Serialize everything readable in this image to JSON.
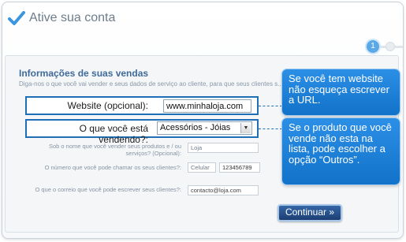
{
  "header": {
    "title": "Ative sua conta"
  },
  "steps": {
    "current": "1"
  },
  "section": {
    "title": "Informações de suas vendas",
    "description": "Diga-nos o que você vai vender e seus dados de serviço ao cliente, para que seus clientes s..."
  },
  "fields": {
    "website_label": "Website (opcional):",
    "website_value": "www.minhaloja.com",
    "selling_label": "O que você está vendendo?:",
    "selling_value": "Acessórios - Jóias",
    "name_label": "Sob o nome que você vender seus produtos e / ou serviços? (Opcional):",
    "name_value": "Loja",
    "phone_label": "O número que você pode chamar os seus clientes?:",
    "phone_type": "Celular",
    "phone_value": "123456789",
    "email_label": "O que o correio que você pode escrever seus clientes?:",
    "email_value": "contacto@loja.com"
  },
  "tips": {
    "website": "Se você tem website não esqueça escrever a URL.",
    "selling": "Se o produto que você vende não esta na lista, pode escolher a opção “Outros”."
  },
  "actions": {
    "continue_label": "Continuar »"
  },
  "colors": {
    "accent": "#1f6fb6",
    "bubble": "#1a7fd8",
    "button": "#264f8a",
    "title": "#3f6a9a"
  }
}
